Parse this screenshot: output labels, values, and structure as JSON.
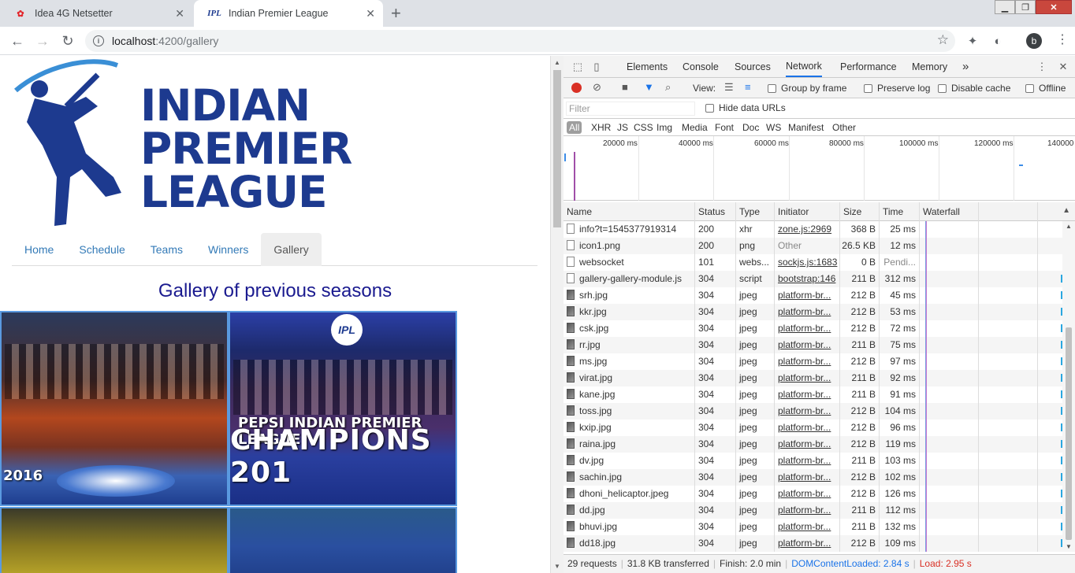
{
  "tabs": [
    {
      "title": "Idea 4G Netsetter",
      "icon": "huawei-icon",
      "active": false
    },
    {
      "title": "Indian Premier League",
      "icon": "ipl-icon",
      "active": true
    }
  ],
  "url": {
    "host": "localhost",
    "rest": ":4200/gallery"
  },
  "page": {
    "logo": {
      "line1": "INDIAN",
      "line2": "PREMIER",
      "line3": "LEAGUE",
      "color": "#1d3a8f"
    },
    "nav": [
      "Home",
      "Schedule",
      "Teams",
      "Winners",
      "Gallery"
    ],
    "active_nav": "Gallery",
    "gallery_title": "Gallery of previous seasons",
    "photos": [
      {
        "caption": "2016"
      },
      {
        "caption1": "PEPSI INDIAN PREMIER LEAGUE",
        "caption2": "CHAMPIONS 201",
        "badge": "IPL"
      },
      {
        "caption": ""
      },
      {
        "caption": ""
      }
    ]
  },
  "devtools": {
    "tabs": [
      "Elements",
      "Console",
      "Sources",
      "Network",
      "Performance",
      "Memory"
    ],
    "active_tab": "Network",
    "more": "»",
    "toolbar": {
      "view_label": "View:",
      "group_by_frame": "Group by frame",
      "preserve_log": "Preserve log",
      "disable_cache": "Disable cache",
      "offline": "Offline"
    },
    "filter_placeholder": "Filter",
    "hide_data_urls": "Hide data URLs",
    "types": [
      "All",
      "XHR",
      "JS",
      "CSS",
      "Img",
      "Media",
      "Font",
      "Doc",
      "WS",
      "Manifest",
      "Other"
    ],
    "timeline_labels": [
      "20000 ms",
      "40000 ms",
      "60000 ms",
      "80000 ms",
      "100000 ms",
      "120000 ms",
      "140000"
    ],
    "columns": [
      "Name",
      "Status",
      "Type",
      "Initiator",
      "Size",
      "Time",
      "Waterfall"
    ],
    "requests": [
      {
        "name": "info?t=1545377919314",
        "status": "200",
        "type": "xhr",
        "initiator": "zone.js:2969",
        "size": "368 B",
        "time": "25 ms",
        "kind": "doc"
      },
      {
        "name": "icon1.png",
        "status": "200",
        "type": "png",
        "initiator": "Other",
        "size": "26.5 KB",
        "time": "12 ms",
        "kind": "doc"
      },
      {
        "name": "websocket",
        "status": "101",
        "type": "webs...",
        "initiator": "sockjs.js:1683",
        "size": "0 B",
        "time": "Pendi...",
        "kind": "doc"
      },
      {
        "name": "gallery-gallery-module.js",
        "status": "304",
        "type": "script",
        "initiator": "bootstrap:146",
        "size": "211 B",
        "time": "312 ms",
        "kind": "doc"
      },
      {
        "name": "srh.jpg",
        "status": "304",
        "type": "jpeg",
        "initiator": "platform-br...",
        "size": "212 B",
        "time": "45 ms",
        "kind": "img"
      },
      {
        "name": "kkr.jpg",
        "status": "304",
        "type": "jpeg",
        "initiator": "platform-br...",
        "size": "212 B",
        "time": "53 ms",
        "kind": "img"
      },
      {
        "name": "csk.jpg",
        "status": "304",
        "type": "jpeg",
        "initiator": "platform-br...",
        "size": "212 B",
        "time": "72 ms",
        "kind": "img"
      },
      {
        "name": "rr.jpg",
        "status": "304",
        "type": "jpeg",
        "initiator": "platform-br...",
        "size": "211 B",
        "time": "75 ms",
        "kind": "img"
      },
      {
        "name": "ms.jpg",
        "status": "304",
        "type": "jpeg",
        "initiator": "platform-br...",
        "size": "212 B",
        "time": "97 ms",
        "kind": "img"
      },
      {
        "name": "virat.jpg",
        "status": "304",
        "type": "jpeg",
        "initiator": "platform-br...",
        "size": "211 B",
        "time": "92 ms",
        "kind": "img"
      },
      {
        "name": "kane.jpg",
        "status": "304",
        "type": "jpeg",
        "initiator": "platform-br...",
        "size": "211 B",
        "time": "91 ms",
        "kind": "img"
      },
      {
        "name": "toss.jpg",
        "status": "304",
        "type": "jpeg",
        "initiator": "platform-br...",
        "size": "212 B",
        "time": "104 ms",
        "kind": "img"
      },
      {
        "name": "kxip.jpg",
        "status": "304",
        "type": "jpeg",
        "initiator": "platform-br...",
        "size": "212 B",
        "time": "96 ms",
        "kind": "img"
      },
      {
        "name": "raina.jpg",
        "status": "304",
        "type": "jpeg",
        "initiator": "platform-br...",
        "size": "212 B",
        "time": "119 ms",
        "kind": "img"
      },
      {
        "name": "dv.jpg",
        "status": "304",
        "type": "jpeg",
        "initiator": "platform-br...",
        "size": "211 B",
        "time": "103 ms",
        "kind": "img"
      },
      {
        "name": "sachin.jpg",
        "status": "304",
        "type": "jpeg",
        "initiator": "platform-br...",
        "size": "212 B",
        "time": "102 ms",
        "kind": "img"
      },
      {
        "name": "dhoni_helicaptor.jpeg",
        "status": "304",
        "type": "jpeg",
        "initiator": "platform-br...",
        "size": "212 B",
        "time": "126 ms",
        "kind": "img"
      },
      {
        "name": "dd.jpg",
        "status": "304",
        "type": "jpeg",
        "initiator": "platform-br...",
        "size": "211 B",
        "time": "112 ms",
        "kind": "img"
      },
      {
        "name": "bhuvi.jpg",
        "status": "304",
        "type": "jpeg",
        "initiator": "platform-br...",
        "size": "211 B",
        "time": "132 ms",
        "kind": "img"
      },
      {
        "name": "dd18.jpg",
        "status": "304",
        "type": "jpeg",
        "initiator": "platform-br...",
        "size": "212 B",
        "time": "109 ms",
        "kind": "img"
      }
    ],
    "status": {
      "requests": "29 requests",
      "transferred": "31.8 KB transferred",
      "finish": "Finish: 2.0 min",
      "dcl": "DOMContentLoaded: 2.84 s",
      "load": "Load: 2.95 s"
    }
  }
}
